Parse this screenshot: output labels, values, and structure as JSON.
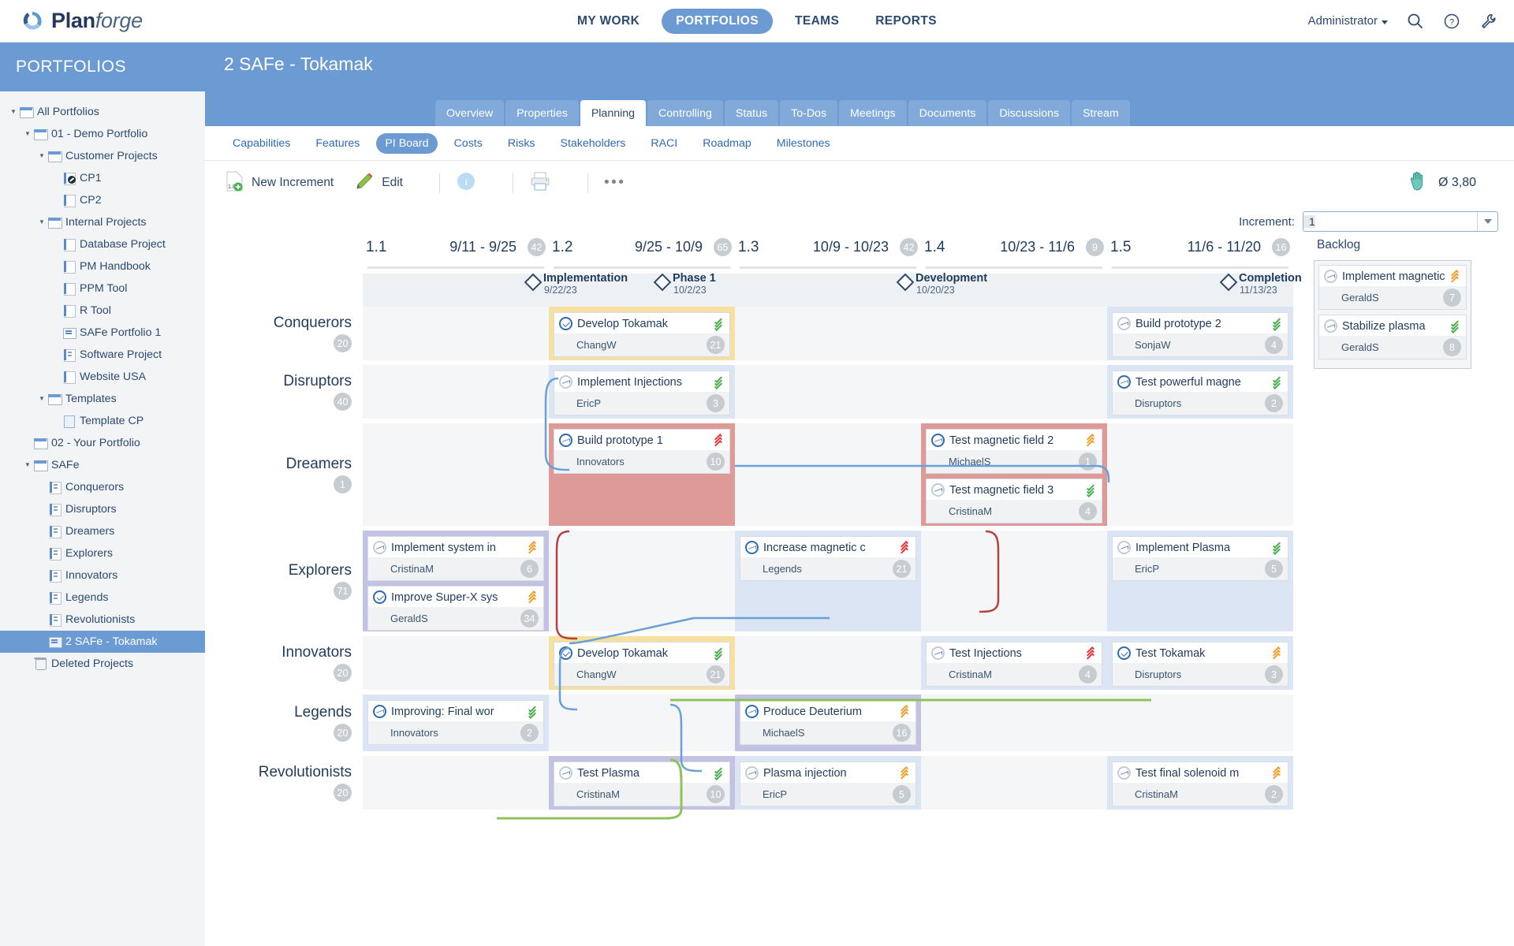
{
  "app": {
    "brand_main": "Plan",
    "brand_italic": "forge",
    "nav": [
      {
        "label": "MY WORK",
        "active": false
      },
      {
        "label": "PORTFOLIOS",
        "active": true
      },
      {
        "label": "TEAMS",
        "active": false
      },
      {
        "label": "REPORTS",
        "active": false
      }
    ],
    "user": "Administrator",
    "icons": [
      "search-icon",
      "help-icon",
      "tools-icon"
    ]
  },
  "sidebar": {
    "title": "PORTFOLIOS",
    "items": [
      {
        "label": "All Portfolios",
        "depth": 0,
        "twisty": "▼",
        "icon": "folder",
        "selected": false
      },
      {
        "label": "01 - Demo Portfolio",
        "depth": 1,
        "twisty": "▼",
        "icon": "folder",
        "selected": false
      },
      {
        "label": "Customer Projects",
        "depth": 2,
        "twisty": "▼",
        "icon": "folder",
        "selected": false
      },
      {
        "label": "CP1",
        "depth": 3,
        "twisty": "",
        "icon": "proj-check",
        "selected": false
      },
      {
        "label": "CP2",
        "depth": 3,
        "twisty": "",
        "icon": "proj",
        "selected": false
      },
      {
        "label": "Internal Projects",
        "depth": 2,
        "twisty": "▼",
        "icon": "folder",
        "selected": false
      },
      {
        "label": "Database Project",
        "depth": 3,
        "twisty": "",
        "icon": "proj",
        "selected": false
      },
      {
        "label": "PM Handbook",
        "depth": 3,
        "twisty": "",
        "icon": "proj",
        "selected": false
      },
      {
        "label": "PPM Tool",
        "depth": 3,
        "twisty": "",
        "icon": "proj",
        "selected": false
      },
      {
        "label": "R Tool",
        "depth": 3,
        "twisty": "",
        "icon": "proj",
        "selected": false
      },
      {
        "label": "SAFe Portfolio 1",
        "depth": 3,
        "twisty": "",
        "icon": "board",
        "selected": false
      },
      {
        "label": "Software Project",
        "depth": 3,
        "twisty": "",
        "icon": "team",
        "selected": false
      },
      {
        "label": "Website USA",
        "depth": 3,
        "twisty": "",
        "icon": "proj",
        "selected": false
      },
      {
        "label": "Templates",
        "depth": 2,
        "twisty": "▼",
        "icon": "folder",
        "selected": false
      },
      {
        "label": "Template CP",
        "depth": 3,
        "twisty": "",
        "icon": "page",
        "selected": false
      },
      {
        "label": "02 - Your Portfolio",
        "depth": 1,
        "twisty": "",
        "icon": "folder",
        "selected": false
      },
      {
        "label": "SAFe",
        "depth": 1,
        "twisty": "▼",
        "icon": "folder",
        "selected": false
      },
      {
        "label": "Conquerors",
        "depth": 2,
        "twisty": "",
        "icon": "team",
        "selected": false
      },
      {
        "label": "Disruptors",
        "depth": 2,
        "twisty": "",
        "icon": "team",
        "selected": false
      },
      {
        "label": "Dreamers",
        "depth": 2,
        "twisty": "",
        "icon": "team",
        "selected": false
      },
      {
        "label": "Explorers",
        "depth": 2,
        "twisty": "",
        "icon": "team",
        "selected": false
      },
      {
        "label": "Innovators",
        "depth": 2,
        "twisty": "",
        "icon": "team",
        "selected": false
      },
      {
        "label": "Legends",
        "depth": 2,
        "twisty": "",
        "icon": "team",
        "selected": false
      },
      {
        "label": "Revolutionists",
        "depth": 2,
        "twisty": "",
        "icon": "team",
        "selected": false
      },
      {
        "label": "2 SAFe - Tokamak",
        "depth": 2,
        "twisty": "",
        "icon": "board-blue",
        "selected": true
      },
      {
        "label": "Deleted Projects",
        "depth": 1,
        "twisty": "",
        "icon": "trash",
        "selected": false
      }
    ]
  },
  "project": {
    "title": "2 SAFe - Tokamak",
    "tabs": [
      {
        "label": "Overview",
        "active": false
      },
      {
        "label": "Properties",
        "active": false
      },
      {
        "label": "Planning",
        "active": true
      },
      {
        "label": "Controlling",
        "active": false
      },
      {
        "label": "Status",
        "active": false
      },
      {
        "label": "To-Dos",
        "active": false
      },
      {
        "label": "Meetings",
        "active": false
      },
      {
        "label": "Documents",
        "active": false
      },
      {
        "label": "Discussions",
        "active": false
      },
      {
        "label": "Stream",
        "active": false
      }
    ],
    "subtabs": [
      {
        "label": "Capabilities",
        "active": false
      },
      {
        "label": "Features",
        "active": false
      },
      {
        "label": "PI Board",
        "active": true
      },
      {
        "label": "Costs",
        "active": false
      },
      {
        "label": "Risks",
        "active": false
      },
      {
        "label": "Stakeholders",
        "active": false
      },
      {
        "label": "RACI",
        "active": false
      },
      {
        "label": "Roadmap",
        "active": false
      },
      {
        "label": "Milestones",
        "active": false
      }
    ]
  },
  "toolbar": {
    "new_increment": "New Increment",
    "edit": "Edit",
    "more": "•••",
    "avg_label": "Ø 3,80",
    "increment_label": "Increment:",
    "increment_value": "1"
  },
  "board": {
    "columns": [
      {
        "num": "1.1",
        "range": "9/11 - 9/25",
        "count": "42"
      },
      {
        "num": "1.2",
        "range": "9/25 - 10/9",
        "count": "65"
      },
      {
        "num": "1.3",
        "range": "10/9 - 10/23",
        "count": "42"
      },
      {
        "num": "1.4",
        "range": "10/23 - 11/6",
        "count": "9"
      },
      {
        "num": "1.5",
        "range": "11/6 - 11/20",
        "count": "16"
      }
    ],
    "milestones": [
      {
        "name": "Implementation",
        "date": "9/22/23",
        "left": "208"
      },
      {
        "name": "Phase 1",
        "date": "10/2/23",
        "left": "372"
      },
      {
        "name": "Development",
        "date": "10/20/23",
        "left": "680"
      },
      {
        "name": "Completion",
        "date": "11/13/23",
        "left": "1090"
      }
    ],
    "rows": [
      {
        "team": "Conquerors",
        "count": "20",
        "cells": [
          {
            "fill": "plain",
            "cards": []
          },
          {
            "fill": "yellow",
            "cards": [
              {
                "title": "Develop Tokamak",
                "owner": "ChangW",
                "points": "21",
                "icon": "check",
                "chev": "down-green"
              }
            ]
          },
          {
            "fill": "plain",
            "cards": []
          },
          {
            "fill": "plain",
            "cards": []
          },
          {
            "fill": "alt",
            "cards": [
              {
                "title": "Build prototype 2",
                "owner": "SonjaW",
                "points": "4",
                "icon": "wave",
                "chev": "down-green"
              }
            ]
          }
        ]
      },
      {
        "team": "Disruptors",
        "count": "40",
        "cells": [
          {
            "fill": "plain",
            "cards": []
          },
          {
            "fill": "alt",
            "cards": [
              {
                "title": "Implement Injections",
                "owner": "EricP",
                "points": "3",
                "icon": "wave",
                "chev": "down-green"
              }
            ]
          },
          {
            "fill": "plain",
            "cards": []
          },
          {
            "fill": "plain",
            "cards": []
          },
          {
            "fill": "alt",
            "cards": [
              {
                "title": "Test powerful magne",
                "owner": "Disruptors",
                "points": "2",
                "icon": "wave-on",
                "chev": "down-green"
              }
            ]
          }
        ]
      },
      {
        "team": "Dreamers",
        "count": "1",
        "cells": [
          {
            "fill": "plain",
            "cards": []
          },
          {
            "fill": "red",
            "cards": [
              {
                "title": "Build prototype 1",
                "owner": "Innovators",
                "points": "10",
                "icon": "wave-on",
                "chev": "up-red"
              }
            ]
          },
          {
            "fill": "plain",
            "cards": []
          },
          {
            "fill": "red",
            "cards": [
              {
                "title": "Test magnetic field 2",
                "owner": "MichaelS",
                "points": "1",
                "icon": "wave-on",
                "chev": "up-orange"
              },
              {
                "title": "Test magnetic field 3",
                "owner": "CristinaM",
                "points": "4",
                "icon": "wave",
                "chev": "down-green"
              }
            ]
          },
          {
            "fill": "plain",
            "cards": []
          }
        ]
      },
      {
        "team": "Explorers",
        "count": "71",
        "cells": [
          {
            "fill": "purple",
            "cards": [
              {
                "title": "Implement system in",
                "owner": "CristinaM",
                "points": "6",
                "icon": "wave",
                "chev": "up-orange"
              },
              {
                "title": "Improve Super-X sys",
                "owner": "GeraldS",
                "points": "34",
                "icon": "check",
                "chev": "up-orange"
              }
            ]
          },
          {
            "fill": "plain",
            "cards": []
          },
          {
            "fill": "alt",
            "cards": [
              {
                "title": "Increase magnetic c",
                "owner": "Legends",
                "points": "21",
                "icon": "wave-on",
                "chev": "up-red"
              }
            ]
          },
          {
            "fill": "plain",
            "cards": []
          },
          {
            "fill": "alt",
            "cards": [
              {
                "title": "Implement Plasma",
                "owner": "EricP",
                "points": "5",
                "icon": "wave",
                "chev": "down-green"
              }
            ]
          }
        ]
      },
      {
        "team": "Innovators",
        "count": "20",
        "cells": [
          {
            "fill": "plain",
            "cards": []
          },
          {
            "fill": "yellow",
            "cards": [
              {
                "title": "Develop Tokamak",
                "owner": "ChangW",
                "points": "21",
                "icon": "check",
                "chev": "down-green"
              }
            ]
          },
          {
            "fill": "plain",
            "cards": []
          },
          {
            "fill": "alt",
            "cards": [
              {
                "title": "Test Injections",
                "owner": "CristinaM",
                "points": "4",
                "icon": "wave",
                "chev": "up-red"
              }
            ]
          },
          {
            "fill": "alt",
            "cards": [
              {
                "title": "Test Tokamak",
                "owner": "Disruptors",
                "points": "3",
                "icon": "check",
                "chev": "up-orange"
              }
            ]
          }
        ]
      },
      {
        "team": "Legends",
        "count": "20",
        "cells": [
          {
            "fill": "alt",
            "cards": [
              {
                "title": "Improving: Final wor",
                "owner": "Innovators",
                "points": "2",
                "icon": "wave-on",
                "chev": "down-green"
              }
            ]
          },
          {
            "fill": "plain",
            "cards": []
          },
          {
            "fill": "purple",
            "cards": [
              {
                "title": "Produce Deuterium",
                "owner": "MichaelS",
                "points": "16",
                "icon": "wave-on",
                "chev": "up-orange"
              }
            ]
          },
          {
            "fill": "plain",
            "cards": []
          },
          {
            "fill": "plain",
            "cards": []
          }
        ]
      },
      {
        "team": "Revolutionists",
        "count": "20",
        "cells": [
          {
            "fill": "plain",
            "cards": []
          },
          {
            "fill": "purple",
            "cards": [
              {
                "title": "Test Plasma",
                "owner": "CristinaM",
                "points": "10",
                "icon": "wave",
                "chev": "down-green"
              }
            ]
          },
          {
            "fill": "alt",
            "cards": [
              {
                "title": "Plasma injection",
                "owner": "EricP",
                "points": "5",
                "icon": "wave",
                "chev": "up-orange"
              }
            ]
          },
          {
            "fill": "plain",
            "cards": []
          },
          {
            "fill": "alt",
            "cards": [
              {
                "title": "Test final solenoid m",
                "owner": "CristinaM",
                "points": "2",
                "icon": "wave",
                "chev": "up-orange"
              }
            ]
          }
        ]
      }
    ]
  },
  "backlog": {
    "title": "Backlog",
    "cards": [
      {
        "title": "Implement magnetic",
        "owner": "GeraldS",
        "points": "7",
        "icon": "wave",
        "chev": "up-orange"
      },
      {
        "title": "Stabilize plasma",
        "owner": "GeraldS",
        "points": "8",
        "icon": "wave",
        "chev": "down-green"
      }
    ]
  },
  "colors": {
    "brand_blue": "#6b9bd2",
    "dark_navy": "#1f3b5c",
    "cell_alt": "#dbe5f3",
    "cell_red": "#dd9a97",
    "cell_yellow": "#f7dfa0",
    "cell_purple": "#c3c2e2",
    "link_blue": "#6aa0d8",
    "link_red": "#b5423f",
    "link_green": "#8fc25c"
  }
}
